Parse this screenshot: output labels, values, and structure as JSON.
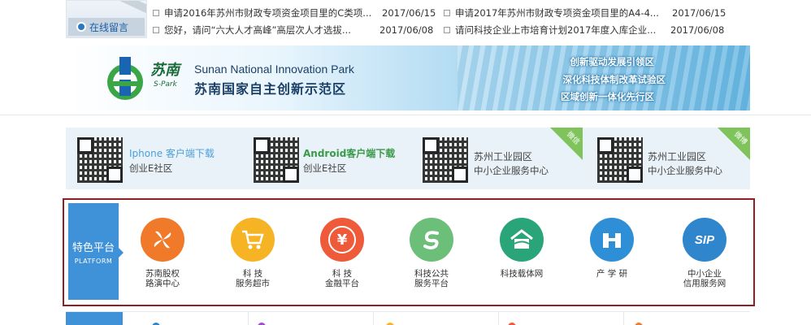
{
  "message": {
    "label": "在线留言"
  },
  "news": [
    {
      "title": "申请2016年苏州市财政专项资金项目里的C类项...",
      "date": "2017/06/15"
    },
    {
      "title": "申请2017年苏州市财政专项资金项目里的A4-4...",
      "date": "2017/06/15"
    },
    {
      "title": "您好，请问“六大人才高峰”高层次人才选拔...",
      "date": "2017/06/08"
    },
    {
      "title": "请问科技企业上市培育计划2017年度入库企业...",
      "date": "2017/06/08"
    }
  ],
  "banner": {
    "logo_cn": "苏南",
    "logo_sub": "S-Park",
    "name_en": "Sunan National Innovation Park",
    "name_cn": "苏南国家自主创新示范区",
    "slogans": [
      "创新驱动发展引领区",
      "深化科技体制改革试验区",
      "区域创新一体化先行区"
    ]
  },
  "qr_codes": [
    {
      "title": "Iphone 客户端下载",
      "subtitle": "创业E社区",
      "title_color": "#4a9fd8"
    },
    {
      "title": "Android客户端下载",
      "subtitle": "创业E社区",
      "title_color": "#3a9a4a"
    },
    {
      "title": "苏州工业园区",
      "subtitle": "中小企业服务中心",
      "title_color": "#444444",
      "tag": "微信"
    },
    {
      "title": "苏州工业园区",
      "subtitle": "中小企业服务中心",
      "title_color": "#444444",
      "tag": "微博"
    }
  ],
  "platform": {
    "title": "特色平台",
    "subtitle": "PLATFORM",
    "items": [
      {
        "line1": "苏南股权",
        "line2": "路演中心",
        "icon": "fan-icon",
        "color": "#f07a2a",
        "glyph": "✦"
      },
      {
        "line1": "科 技",
        "line2": "服务超市",
        "icon": "cart-icon",
        "color": "#f6b324",
        "glyph": "🛒"
      },
      {
        "line1": "科 技",
        "line2": "金融平台",
        "icon": "yen-icon",
        "color": "#ee5a3a",
        "glyph": "¥"
      },
      {
        "line1": "科技公共",
        "line2": "服务平台",
        "icon": "s-swirl-icon",
        "color": "#6cbf79",
        "glyph": "S"
      },
      {
        "line1": "科技载体网",
        "line2": "",
        "icon": "house-icon",
        "color": "#2aa57a",
        "glyph": "⌂"
      },
      {
        "line1": "产 学 研",
        "line2": "",
        "icon": "building-icon",
        "color": "#2f8fd6",
        "glyph": "▣"
      },
      {
        "line1": "中小企业",
        "line2": "信用服务网",
        "icon": "sip-logo-icon",
        "color": "#2f86cc",
        "glyph": "SIP"
      }
    ]
  }
}
